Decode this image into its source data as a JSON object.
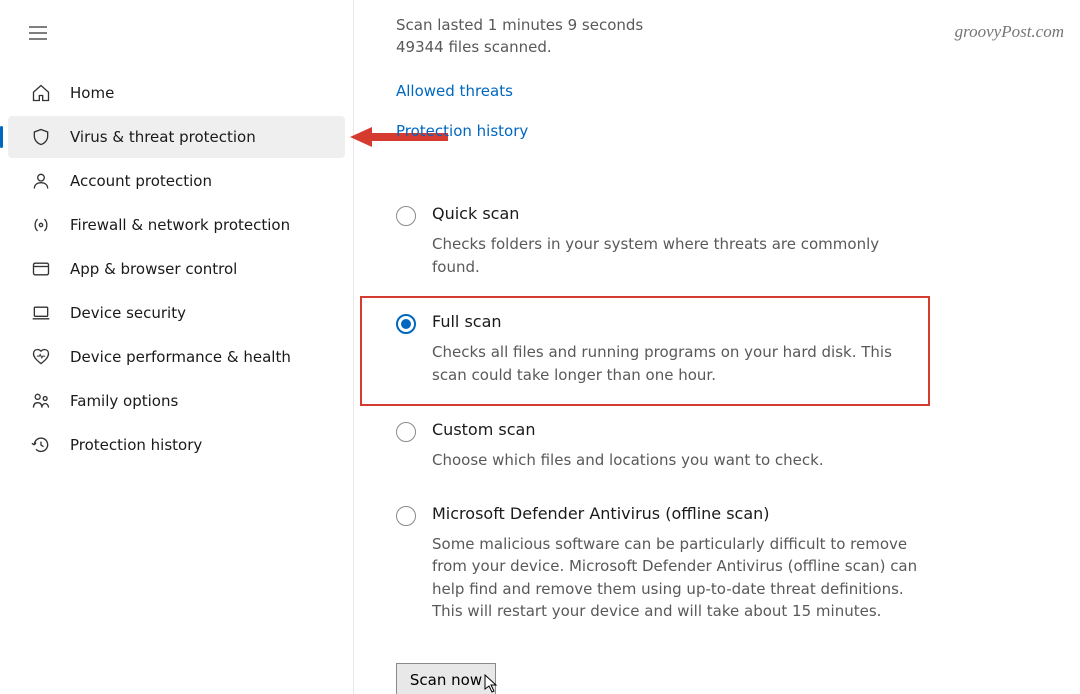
{
  "watermark": "groovyPost.com",
  "sidebar": {
    "items": [
      {
        "label": "Home"
      },
      {
        "label": "Virus & threat protection"
      },
      {
        "label": "Account protection"
      },
      {
        "label": "Firewall & network protection"
      },
      {
        "label": "App & browser control"
      },
      {
        "label": "Device security"
      },
      {
        "label": "Device performance & health"
      },
      {
        "label": "Family options"
      },
      {
        "label": "Protection history"
      }
    ]
  },
  "main": {
    "scan_duration": "Scan lasted 1 minutes 9 seconds",
    "files_scanned": "49344 files scanned.",
    "links": {
      "allowed_threats": "Allowed threats",
      "protection_history": "Protection history"
    },
    "options": [
      {
        "title": "Quick scan",
        "desc": "Checks folders in your system where threats are commonly found."
      },
      {
        "title": "Full scan",
        "desc": "Checks all files and running programs on your hard disk. This scan could take longer than one hour."
      },
      {
        "title": "Custom scan",
        "desc": "Choose which files and locations you want to check."
      },
      {
        "title": "Microsoft Defender Antivirus (offline scan)",
        "desc": "Some malicious software can be particularly difficult to remove from your device. Microsoft Defender Antivirus (offline scan) can help find and remove them using up-to-date threat definitions. This will restart your device and will take about 15 minutes."
      }
    ],
    "scan_button": "Scan now"
  }
}
